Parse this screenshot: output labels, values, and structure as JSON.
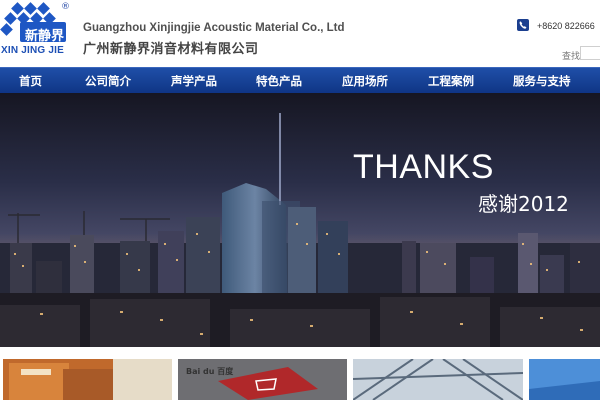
{
  "header": {
    "logo_text": "XIN JING JIE",
    "logo_mark_text": "新静界",
    "logo_registered": "®",
    "company_en": "Guangzhou Xinjingjie Acoustic  Material Co., Ltd",
    "company_cn": "广州新静界消音材料有限公司",
    "phone": "+8620 822666",
    "search_label": "查找"
  },
  "nav": {
    "items": [
      {
        "label": "首页"
      },
      {
        "label": "公司简介"
      },
      {
        "label": "声学产品"
      },
      {
        "label": "特色产品"
      },
      {
        "label": "应用场所"
      },
      {
        "label": "工程案例"
      },
      {
        "label": "服务与支持"
      }
    ]
  },
  "banner": {
    "headline": "THANKS",
    "subline": "感谢2012"
  },
  "thumbnails": {
    "baidu_label": "Bai du 百度"
  },
  "colors": {
    "brand_blue": "#1c4fb4",
    "nav_blue": "#173f95",
    "sky": "#2a2e4a"
  }
}
